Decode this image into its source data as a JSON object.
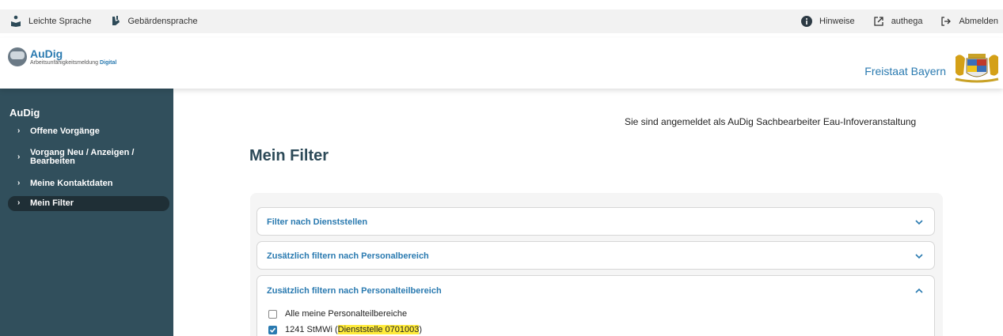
{
  "topbar": {
    "easy_language": "Leichte Sprache",
    "sign_language": "Gebärdensprache",
    "notes": "Hinweise",
    "authega": "authega",
    "logout": "Abmelden"
  },
  "header": {
    "logo_title": "AuDig",
    "logo_sub_prefix": "Arbeitsunfähigkeitsmeldung ",
    "logo_sub_emph": "Digital",
    "state_name": "Freistaat Bayern"
  },
  "sidebar": {
    "title": "AuDig",
    "items": [
      {
        "label": "Offene Vorgänge"
      },
      {
        "label": "Vorgang Neu / Anzeigen / Bearbeiten"
      },
      {
        "label": "Meine Kontaktdaten"
      },
      {
        "label": "Mein Filter"
      }
    ]
  },
  "main": {
    "login_info": "Sie sind angemeldet als AuDig Sachbearbeiter Eau-Infoveranstaltung",
    "title": "Mein Filter",
    "accordions": [
      {
        "label": "Filter nach Dienststellen",
        "expanded": false
      },
      {
        "label": "Zusätzlich filtern nach Personalbereich",
        "expanded": false
      },
      {
        "label": "Zusätzlich filtern nach Personalteilbereich",
        "expanded": true
      }
    ],
    "options": [
      {
        "label": "Alle meine Personalteilbereiche",
        "checked": false
      },
      {
        "label_prefix": "1241 StMWi (",
        "label_highlight": "Dienststelle 0701003",
        "label_suffix": ")",
        "checked": true
      }
    ]
  },
  "colors": {
    "sidebar_bg": "#314f5c",
    "accent": "#2a7ab0",
    "highlight": "#ffeb3b"
  }
}
